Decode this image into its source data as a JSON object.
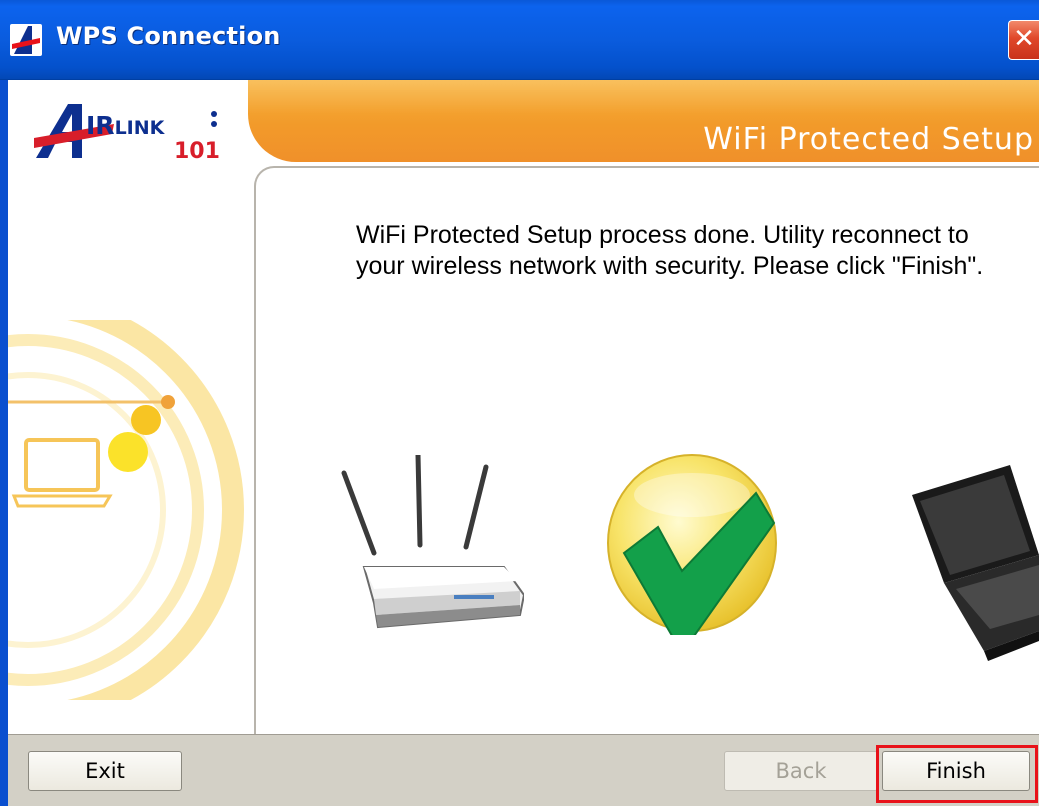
{
  "window": {
    "title": "WPS Connection",
    "close_label": "✕"
  },
  "header": {
    "logo_text": "AIRLINK",
    "logo_number": "101",
    "banner_text": "WiFi Protected Setup"
  },
  "main": {
    "message": "WiFi Protected Setup process done. Utility reconnect to your wireless network with security. Please click \"Finish\"."
  },
  "footer": {
    "exit_label": "Exit",
    "back_label": "Back",
    "finish_label": "Finish"
  },
  "colors": {
    "title_bar": "#0a5cde",
    "banner": "#f29a2a",
    "check_green": "#13a04a",
    "highlight": "#e8121a"
  }
}
